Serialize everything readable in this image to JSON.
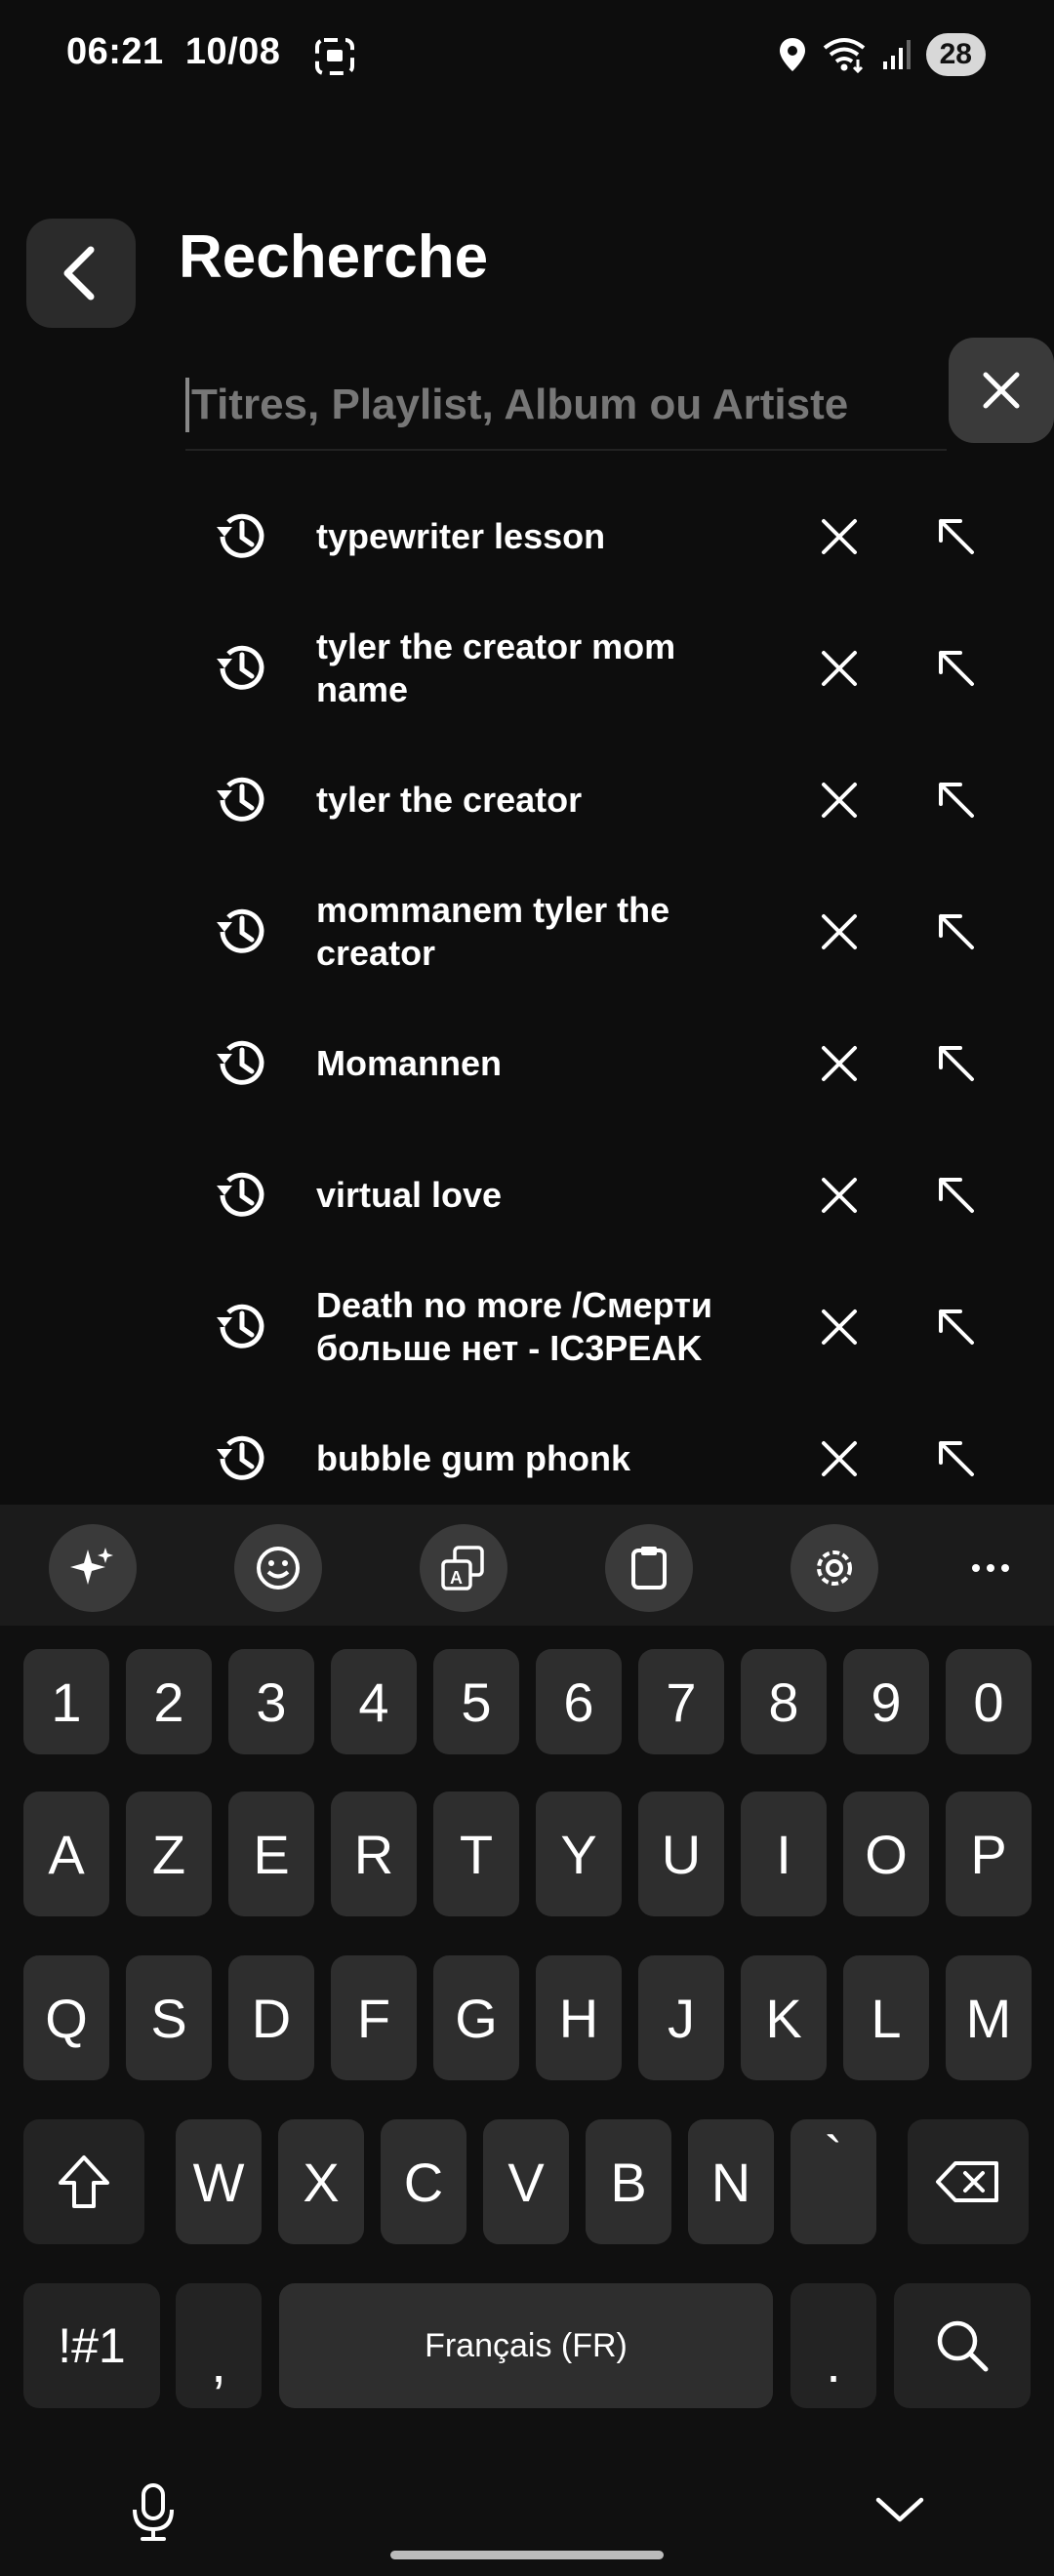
{
  "status_bar": {
    "time": "06:21",
    "date": "10/08",
    "battery": "28"
  },
  "header": {
    "title": "Recherche"
  },
  "search": {
    "placeholder": "Titres, Playlist, Album ou Artiste",
    "value": ""
  },
  "history": [
    {
      "text": "typewriter lesson"
    },
    {
      "text": "tyler the creator mom name"
    },
    {
      "text": "tyler the creator"
    },
    {
      "text": "mommanem tyler the creator"
    },
    {
      "text": "Momannen"
    },
    {
      "text": "virtual love"
    },
    {
      "text": "Death no more /Смерти больше нет - IC3PEAK"
    },
    {
      "text": "bubble gum phonk"
    }
  ],
  "keyboard": {
    "toolbar_icons": [
      "sparkle-icon",
      "emoji-icon",
      "translate-icon",
      "clipboard-icon",
      "settings-icon",
      "more-icon"
    ],
    "rows": [
      [
        "1",
        "2",
        "3",
        "4",
        "5",
        "6",
        "7",
        "8",
        "9",
        "0"
      ],
      [
        "A",
        "Z",
        "E",
        "R",
        "T",
        "Y",
        "U",
        "I",
        "O",
        "P"
      ],
      [
        "Q",
        "S",
        "D",
        "F",
        "G",
        "H",
        "J",
        "K",
        "L",
        "M"
      ],
      [
        "W",
        "X",
        "C",
        "V",
        "B",
        "N",
        "`"
      ]
    ],
    "symbols_label": "!#1",
    "comma": ",",
    "space_label": "Français (FR)",
    "period": "."
  }
}
